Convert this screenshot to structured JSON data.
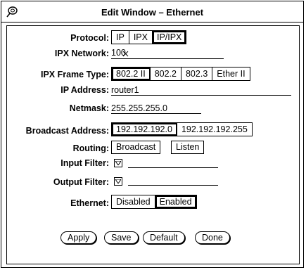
{
  "window": {
    "title": "Edit Window – Ethernet",
    "menu_icon": "window-menu-icon"
  },
  "form": {
    "protocol": {
      "label": "Protocol:",
      "options": [
        "IP",
        "IPX",
        "IP/IPX"
      ],
      "selected": "IP/IPX"
    },
    "ipx_network": {
      "label": "IPX Network:",
      "value": "100"
    },
    "ipx_frame_type": {
      "label": "IPX Frame Type:",
      "options": [
        "802.2 II",
        "802.2",
        "802.3",
        "Ether II"
      ],
      "selected": "802.2 II"
    },
    "ip_address": {
      "label": "IP Address:",
      "value": "router1"
    },
    "netmask": {
      "label": "Netmask:",
      "value": "255.255.255.0"
    },
    "broadcast_address": {
      "label": "Broadcast Address:",
      "options": [
        "192.192.192.0",
        "192.192.192.255"
      ],
      "selected": "192.192.192.0"
    },
    "routing": {
      "label": "Routing:",
      "broadcast_button": "Broadcast",
      "listen_button": "Listen"
    },
    "input_filter": {
      "label": "Input Filter:",
      "value": ""
    },
    "output_filter": {
      "label": "Output Filter:",
      "value": ""
    },
    "ethernet": {
      "label": "Ethernet:",
      "options": [
        "Disabled",
        "Enabled"
      ],
      "selected": "Enabled"
    }
  },
  "actions": {
    "apply": "Apply",
    "save": "Save",
    "default": "Default",
    "done": "Done"
  }
}
